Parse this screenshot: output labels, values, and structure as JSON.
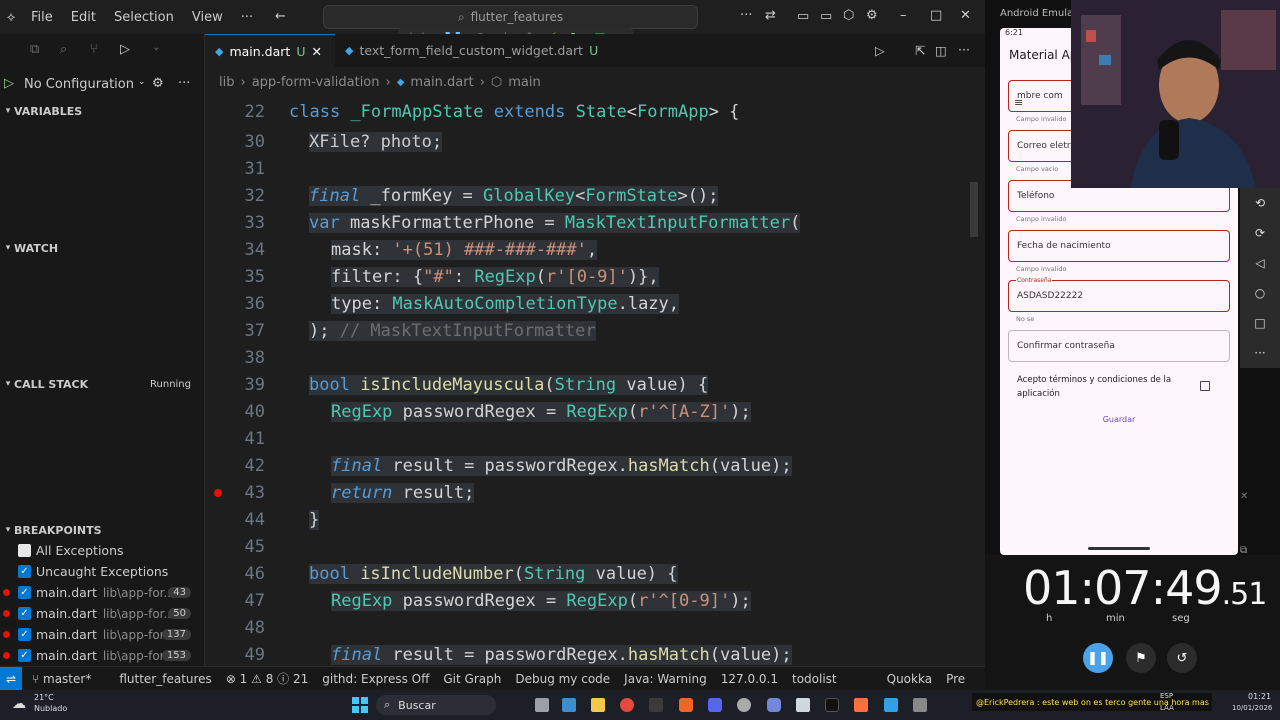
{
  "titlebar": {
    "menus": [
      "File",
      "Edit",
      "Selection",
      "View"
    ],
    "search": "flutter_features"
  },
  "tabs": [
    {
      "name": "main.dart",
      "status": "U",
      "active": true
    },
    {
      "name": "text_form_field_custom_widget.dart",
      "status": "U",
      "active": false
    }
  ],
  "breadcrumb": [
    "lib",
    "app-form-validation",
    "main.dart",
    "main"
  ],
  "run": {
    "config": "No Configuration"
  },
  "sidebar": {
    "variables": "VARIABLES",
    "watch": "WATCH",
    "call_stack": "CALL STACK",
    "call_stack_status": "Running",
    "breakpoints": "BREAKPOINTS",
    "bp_items": [
      {
        "label": "All Exceptions",
        "checked": false
      },
      {
        "label": "Uncaught Exceptions",
        "checked": true
      },
      {
        "label": "main.dart",
        "path": "lib\\app-for...",
        "line": "43",
        "checked": true
      },
      {
        "label": "main.dart",
        "path": "lib\\app-for...",
        "line": "50",
        "checked": true
      },
      {
        "label": "main.dart",
        "path": "lib\\app-for...",
        "line": "137",
        "checked": true
      },
      {
        "label": "main.dart",
        "path": "lib\\app-for...",
        "line": "153",
        "checked": true
      }
    ]
  },
  "editor": {
    "line_numbers": [
      "22",
      "30",
      "31",
      "32",
      "33",
      "34",
      "35",
      "36",
      "37",
      "38",
      "39",
      "40",
      "41",
      "42",
      "43",
      "44",
      "45",
      "46",
      "47",
      "48",
      "49"
    ],
    "sticky_line": "class _FormAppState extends State<FormApp> {",
    "l30": "XFile? photo;",
    "l32a": "final",
    "l32b": " _formKey = ",
    "l32c": "GlobalKey",
    "l32d": "<",
    "l32e": "FormState",
    "l32f": ">();",
    "l33a": "var",
    "l33b": " maskFormatterPhone = ",
    "l33c": "MaskTextInputFormatter",
    "l33d": "(",
    "l34a": "mask: ",
    "l34b": "'+(51) ###-###-###'",
    "l34c": ",",
    "l35a": "filter: {",
    "l35b": "\"#\"",
    "l35c": ": ",
    "l35d": "RegExp",
    "l35e": "(",
    "l35f": "r'[0-9]'",
    "l35g": ")},",
    "l36a": "type: ",
    "l36b": "MaskAutoCompletionType",
    "l36c": ".lazy,",
    "l37a": ");",
    "l37b": " // MaskTextInputFormatter",
    "l39a": "bool",
    "l39b": " isIncludeMayuscula",
    "l39c": "(",
    "l39d": "String",
    "l39e": " value) {",
    "l40a": "RegExp",
    "l40b": " passwordRegex = ",
    "l40c": "RegExp",
    "l40d": "(",
    "l40e": "r'^[A-Z]'",
    "l40f": ");",
    "l42a": "final",
    "l42b": " result = passwordRegex.",
    "l42c": "hasMatch",
    "l42d": "(value);",
    "l43a": "return",
    "l43b": " result;",
    "l44": "}",
    "l46a": "bool",
    "l46b": " isIncludeNumber",
    "l46c": "(",
    "l46d": "String",
    "l46e": " value) {",
    "l47a": "RegExp",
    "l47b": " passwordRegex = ",
    "l47c": "RegExp",
    "l47d": "(",
    "l47e": "r'^[0-9]'",
    "l47f": ");",
    "l49a": "final",
    "l49b": " result = passwordRegex.",
    "l49c": "hasMatch",
    "l49d": "(value);"
  },
  "statusbar": {
    "branch": "master*",
    "project": "flutter_features",
    "problems": "⊗ 1  ⚠ 8  ⓘ 21",
    "github": "githd: Express Off",
    "git_graph": "Git Graph",
    "debug": "Debug my code",
    "java": "Java: Warning",
    "ip": "127.0.0.1",
    "todo": "todolist",
    "quokka": "Quokka",
    "prettier": "Pre"
  },
  "emulator": {
    "window_title": "Android Emulator",
    "clock": "6:21",
    "app_title": "Material Ap",
    "fields": [
      {
        "label": "mbre com",
        "hint": "Campo invalido",
        "error": true
      },
      {
        "label": "Correo eletro",
        "hint": "Campo vacio",
        "error": true
      },
      {
        "label": "Teléfono",
        "hint": "Campo invalido",
        "error": true
      },
      {
        "label": "Fecha de nacimiento",
        "hint": "Campo invalido",
        "error": true
      },
      {
        "label": "ASDASD22222",
        "float_label": "Contraseña",
        "hint": "No se",
        "error": true
      },
      {
        "label": "Confirmar contraseña",
        "hint": "",
        "error": false
      }
    ],
    "terms": "Acepto términos y condiciones de la aplicación",
    "save": "Guardar"
  },
  "stopwatch": {
    "main": "01:07:49",
    "fraction": ".51",
    "units": [
      "h",
      "min",
      "seg"
    ]
  },
  "taskbar": {
    "weather_temp": "21°C",
    "weather_text": "Nublado",
    "search": "Buscar",
    "chat": "@ErickPedrera : este web on es terco gente una hora mas x d",
    "lang": "ESP",
    "lang2": "LAA",
    "time": "01:21",
    "date": "10/01/2026"
  }
}
